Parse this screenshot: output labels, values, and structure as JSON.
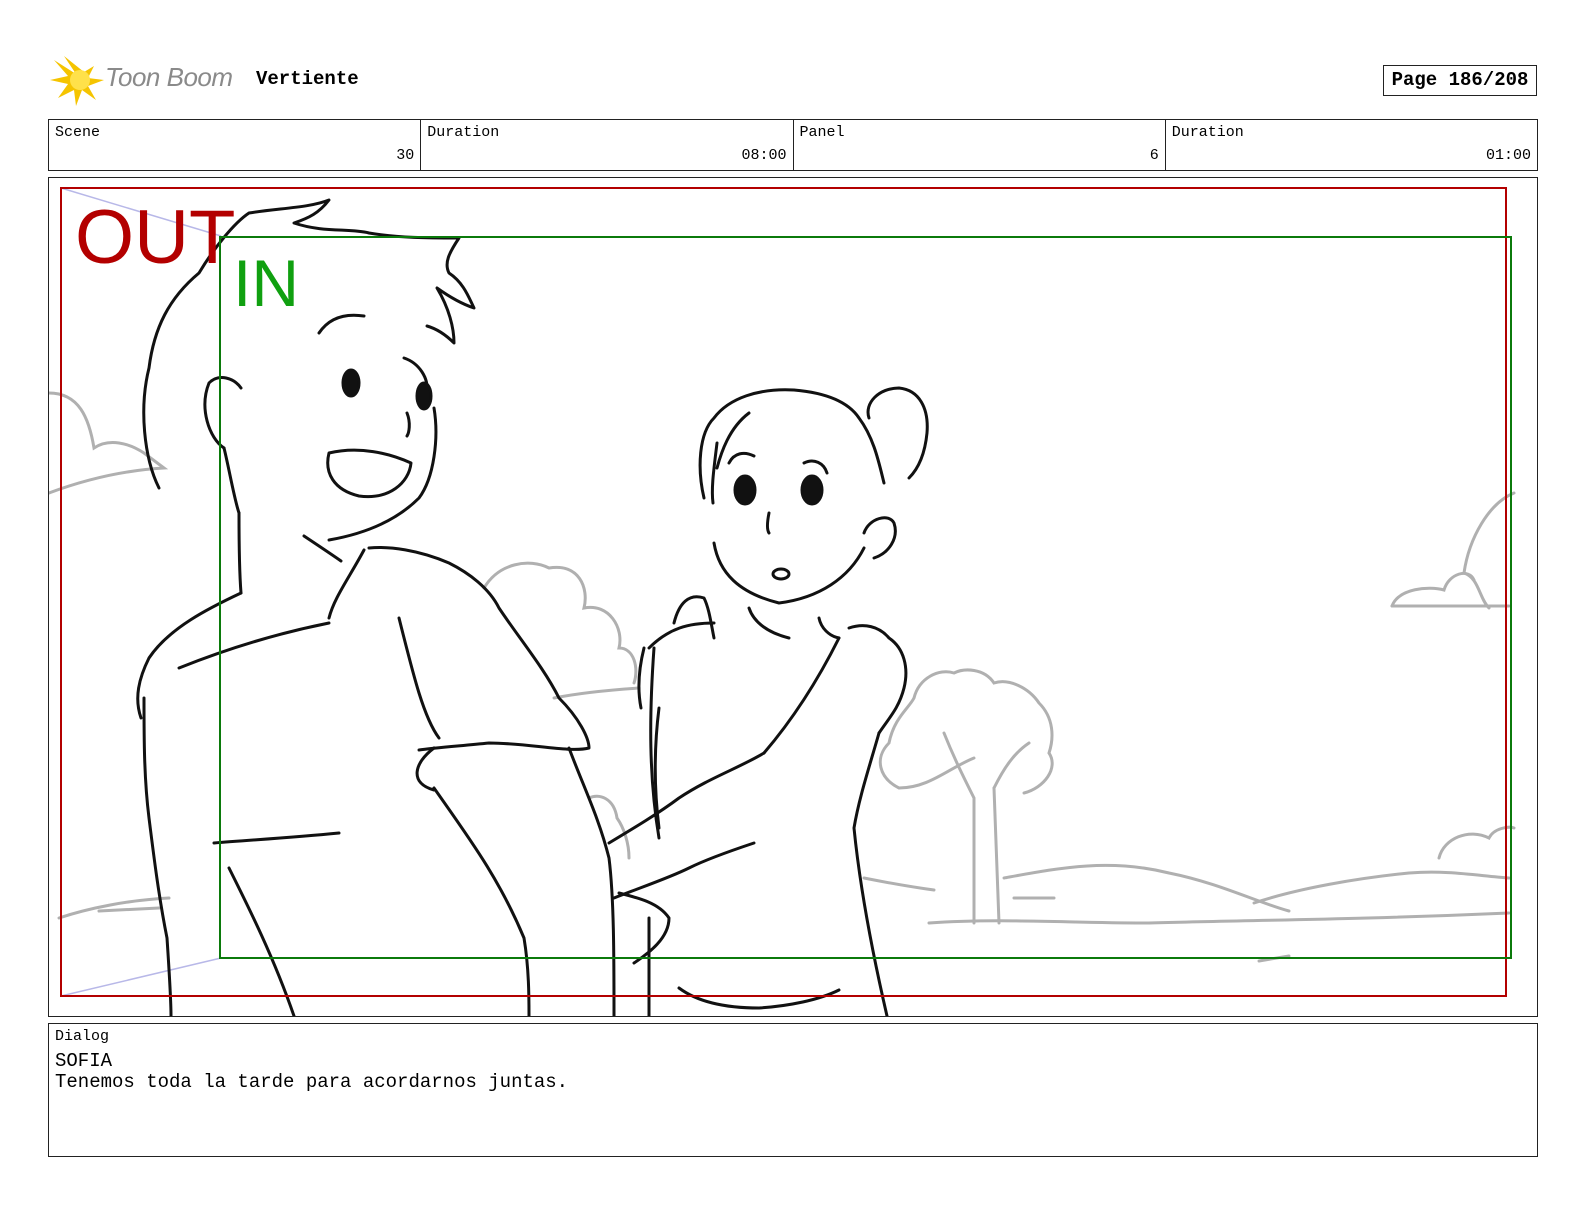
{
  "header": {
    "logo_text": "Toon Boom",
    "project_title": "Vertiente",
    "page": "Page 186/208"
  },
  "info": {
    "scene_label": "Scene",
    "scene_value": "30",
    "scene_duration_label": "Duration",
    "scene_duration_value": "08:00",
    "panel_label": "Panel",
    "panel_value": "6",
    "panel_duration_label": "Duration",
    "panel_duration_value": "01:00"
  },
  "panel": {
    "out_label": "OUT",
    "in_label": "IN",
    "out_color": "#b30000",
    "in_color": "#10a010"
  },
  "dialog": {
    "label": "Dialog",
    "speaker": "SOFIA",
    "line": "Tenemos toda la tarde para acordarnos juntas."
  },
  "icons": {
    "logo": "toon-boom-starburst-icon"
  }
}
